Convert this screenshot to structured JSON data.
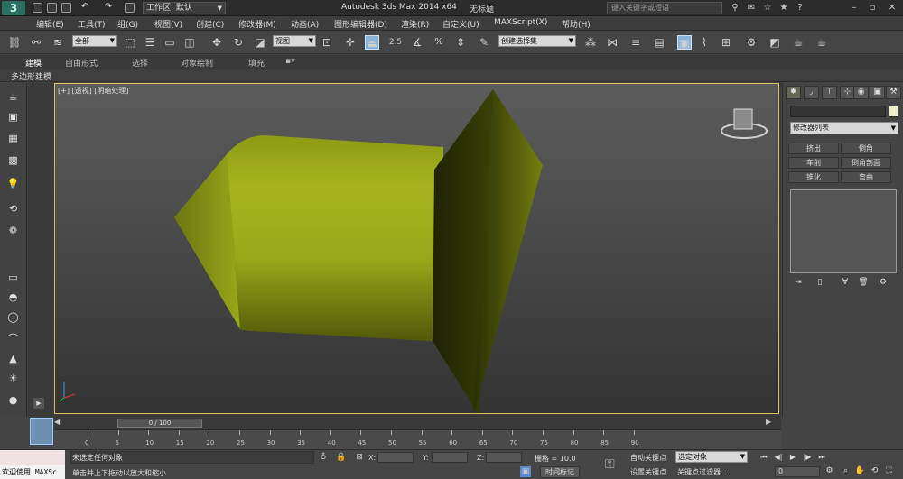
{
  "titlebar": {
    "logo": "3",
    "workspace": "工作区: 默认",
    "app_title": "Autodesk 3ds Max  2014 x64",
    "doc_title": "无标题",
    "search_placeholder": "键入关键字或短语"
  },
  "menu": [
    "编辑(E)",
    "工具(T)",
    "组(G)",
    "视图(V)",
    "创建(C)",
    "修改器(M)",
    "动画(A)",
    "图形编辑器(D)",
    "渲染(R)",
    "自定义(U)",
    "MAXScript(X)",
    "帮助(H)"
  ],
  "toolbar": {
    "filter_dropdown": "全部",
    "ref_coord_dropdown": "视图",
    "spinner_snap": "2.5",
    "percent_snap": "%",
    "named_selection": "创建选择集"
  },
  "ribbon": {
    "tabs": [
      "建模",
      "自由形式",
      "选择",
      "对象绘制",
      "填充"
    ],
    "active_tab": "建模",
    "panel_label": "多边形建模"
  },
  "viewport": {
    "label": "[+] [透视] [明暗处理]",
    "object_color": "#9aa81c",
    "border_color": "#d8c060"
  },
  "command_panel": {
    "modifier_list": "修改器列表",
    "buttons": [
      "挤出",
      "倒角",
      "车削",
      "倒角剖面",
      "锥化",
      "弯曲"
    ],
    "object_color": "#eeeec8"
  },
  "timeline": {
    "slider_label": "0 / 100",
    "ticks": [
      "0",
      "5",
      "10",
      "15",
      "20",
      "25",
      "30",
      "35",
      "40",
      "45",
      "50",
      "55",
      "60",
      "65",
      "70",
      "75",
      "80",
      "85",
      "90"
    ]
  },
  "status": {
    "maxscript_label": "欢迎使用 MAXSc",
    "line1": "未选定任何对象",
    "line2": "单击并上下拖动以放大和缩小",
    "x_label": "X:",
    "y_label": "Y:",
    "z_label": "Z:",
    "grid": "栅格 = 10.0",
    "add_time_tag": "时间标记",
    "auto_key": "自动关键点",
    "set_key": "设置关键点",
    "selection_dropdown": "选定对象",
    "key_filters": "关键点过滤器...",
    "frame": "0"
  }
}
